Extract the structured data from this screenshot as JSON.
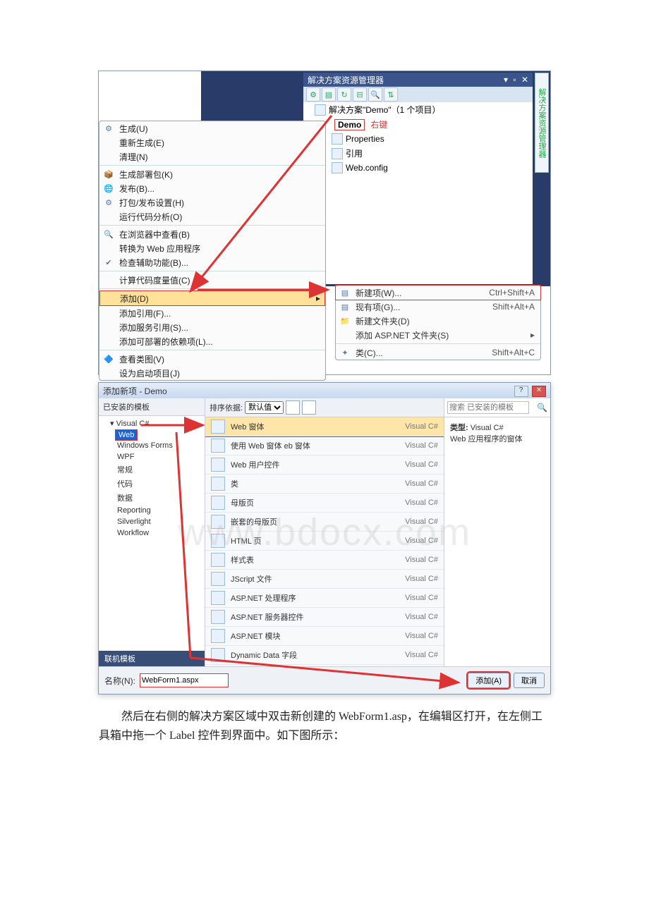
{
  "solutionExplorer": {
    "title": "解决方案资源管理器",
    "toolbar_icons": [
      "props",
      "files",
      "refresh",
      "show",
      "search",
      "nav"
    ],
    "solution_line": "解决方案\"Demo\"（1 个项目）",
    "project_name": "Demo",
    "right_click_label": "右键",
    "nodes": [
      "Properties",
      "引用",
      "Web.config"
    ],
    "vtab_label": "解决方案资源管理器"
  },
  "contextMenu": {
    "items": [
      {
        "label": "生成(U)",
        "icon": "⚙"
      },
      {
        "label": "重新生成(E)",
        "icon": ""
      },
      {
        "label": "清理(N)",
        "icon": ""
      },
      {
        "sep": true
      },
      {
        "label": "生成部署包(K)",
        "icon": "📦"
      },
      {
        "label": "发布(B)...",
        "icon": "🌐"
      },
      {
        "label": "打包/发布设置(H)",
        "icon": "⚙"
      },
      {
        "label": "运行代码分析(O)",
        "icon": ""
      },
      {
        "sep": true
      },
      {
        "label": "在浏览器中查看(B)",
        "icon": "🔍"
      },
      {
        "label": "转换为 Web 应用程序",
        "icon": ""
      },
      {
        "label": "检查辅助功能(B)...",
        "icon": "✔"
      },
      {
        "sep": true
      },
      {
        "label": "计算代码度量值(C)",
        "icon": ""
      },
      {
        "sep": true
      },
      {
        "label": "添加(D)",
        "icon": "",
        "hl": true,
        "arrow": "▸"
      },
      {
        "label": "添加引用(F)...",
        "icon": ""
      },
      {
        "label": "添加服务引用(S)...",
        "icon": ""
      },
      {
        "label": "添加可部署的依赖项(L)...",
        "icon": ""
      },
      {
        "sep": true
      },
      {
        "label": "查看类图(V)",
        "icon": "🔷"
      },
      {
        "label": "设为启动项目(J)",
        "icon": ""
      }
    ]
  },
  "submenu": {
    "items": [
      {
        "label": "新建项(W)...",
        "sc": "Ctrl+Shift+A",
        "icon": "▤",
        "hl": true
      },
      {
        "label": "现有项(G)...",
        "sc": "Shift+Alt+A",
        "icon": "▤"
      },
      {
        "label": "新建文件夹(D)",
        "sc": "",
        "icon": "📁"
      },
      {
        "label": "添加 ASP.NET 文件夹(S)",
        "sc": "▸",
        "icon": ""
      },
      {
        "sep": true
      },
      {
        "label": "类(C)...",
        "sc": "Shift+Alt+C",
        "icon": "✦"
      }
    ]
  },
  "dialog": {
    "title": "添加新项 - Demo",
    "left_section_label": "已安装的模板",
    "tree_root": "Visual C#",
    "tree_items": [
      "Web",
      "Windows Forms",
      "WPF",
      "常规",
      "代码",
      "数据",
      "Reporting",
      "Silverlight",
      "Workflow"
    ],
    "tree_selected": "Web",
    "online_label": "联机模板",
    "sort_label": "排序依据:",
    "sort_value": "默认值",
    "templates": [
      {
        "name": "Web 窗体",
        "type": "Visual C#",
        "sel": true
      },
      {
        "name": "使用 Web 窗体 eb 窗体",
        "type": "Visual C#"
      },
      {
        "name": "Web 用户控件",
        "type": "Visual C#"
      },
      {
        "name": "类",
        "type": "Visual C#"
      },
      {
        "name": "母版页",
        "type": "Visual C#"
      },
      {
        "name": "嵌套的母版页",
        "type": "Visual C#"
      },
      {
        "name": "HTML 页",
        "type": "Visual C#"
      },
      {
        "name": "样式表",
        "type": "Visual C#"
      },
      {
        "name": "JScript 文件",
        "type": "Visual C#"
      },
      {
        "name": "ASP.NET 处理程序",
        "type": "Visual C#"
      },
      {
        "name": "ASP.NET 服务器控件",
        "type": "Visual C#"
      },
      {
        "name": "ASP.NET 模块",
        "type": "Visual C#"
      },
      {
        "name": "Dynamic Data 字段",
        "type": "Visual C#"
      }
    ],
    "search_placeholder": "搜索 已安装的模板",
    "info_type_label": "类型:",
    "info_type_value": "Visual C#",
    "info_desc": "Web 应用程序的窗体",
    "name_label": "名称(N):",
    "name_value": "WebForm1.aspx",
    "btn_add": "添加(A)",
    "btn_cancel": "取消"
  },
  "docText": "然后在右侧的解决方案区域中双击新创建的 WebForm1.asp，在编辑区打开，在左侧工具箱中拖一个 Label 控件到界面中。如下图所示：",
  "watermark": "www.bdocx.com"
}
